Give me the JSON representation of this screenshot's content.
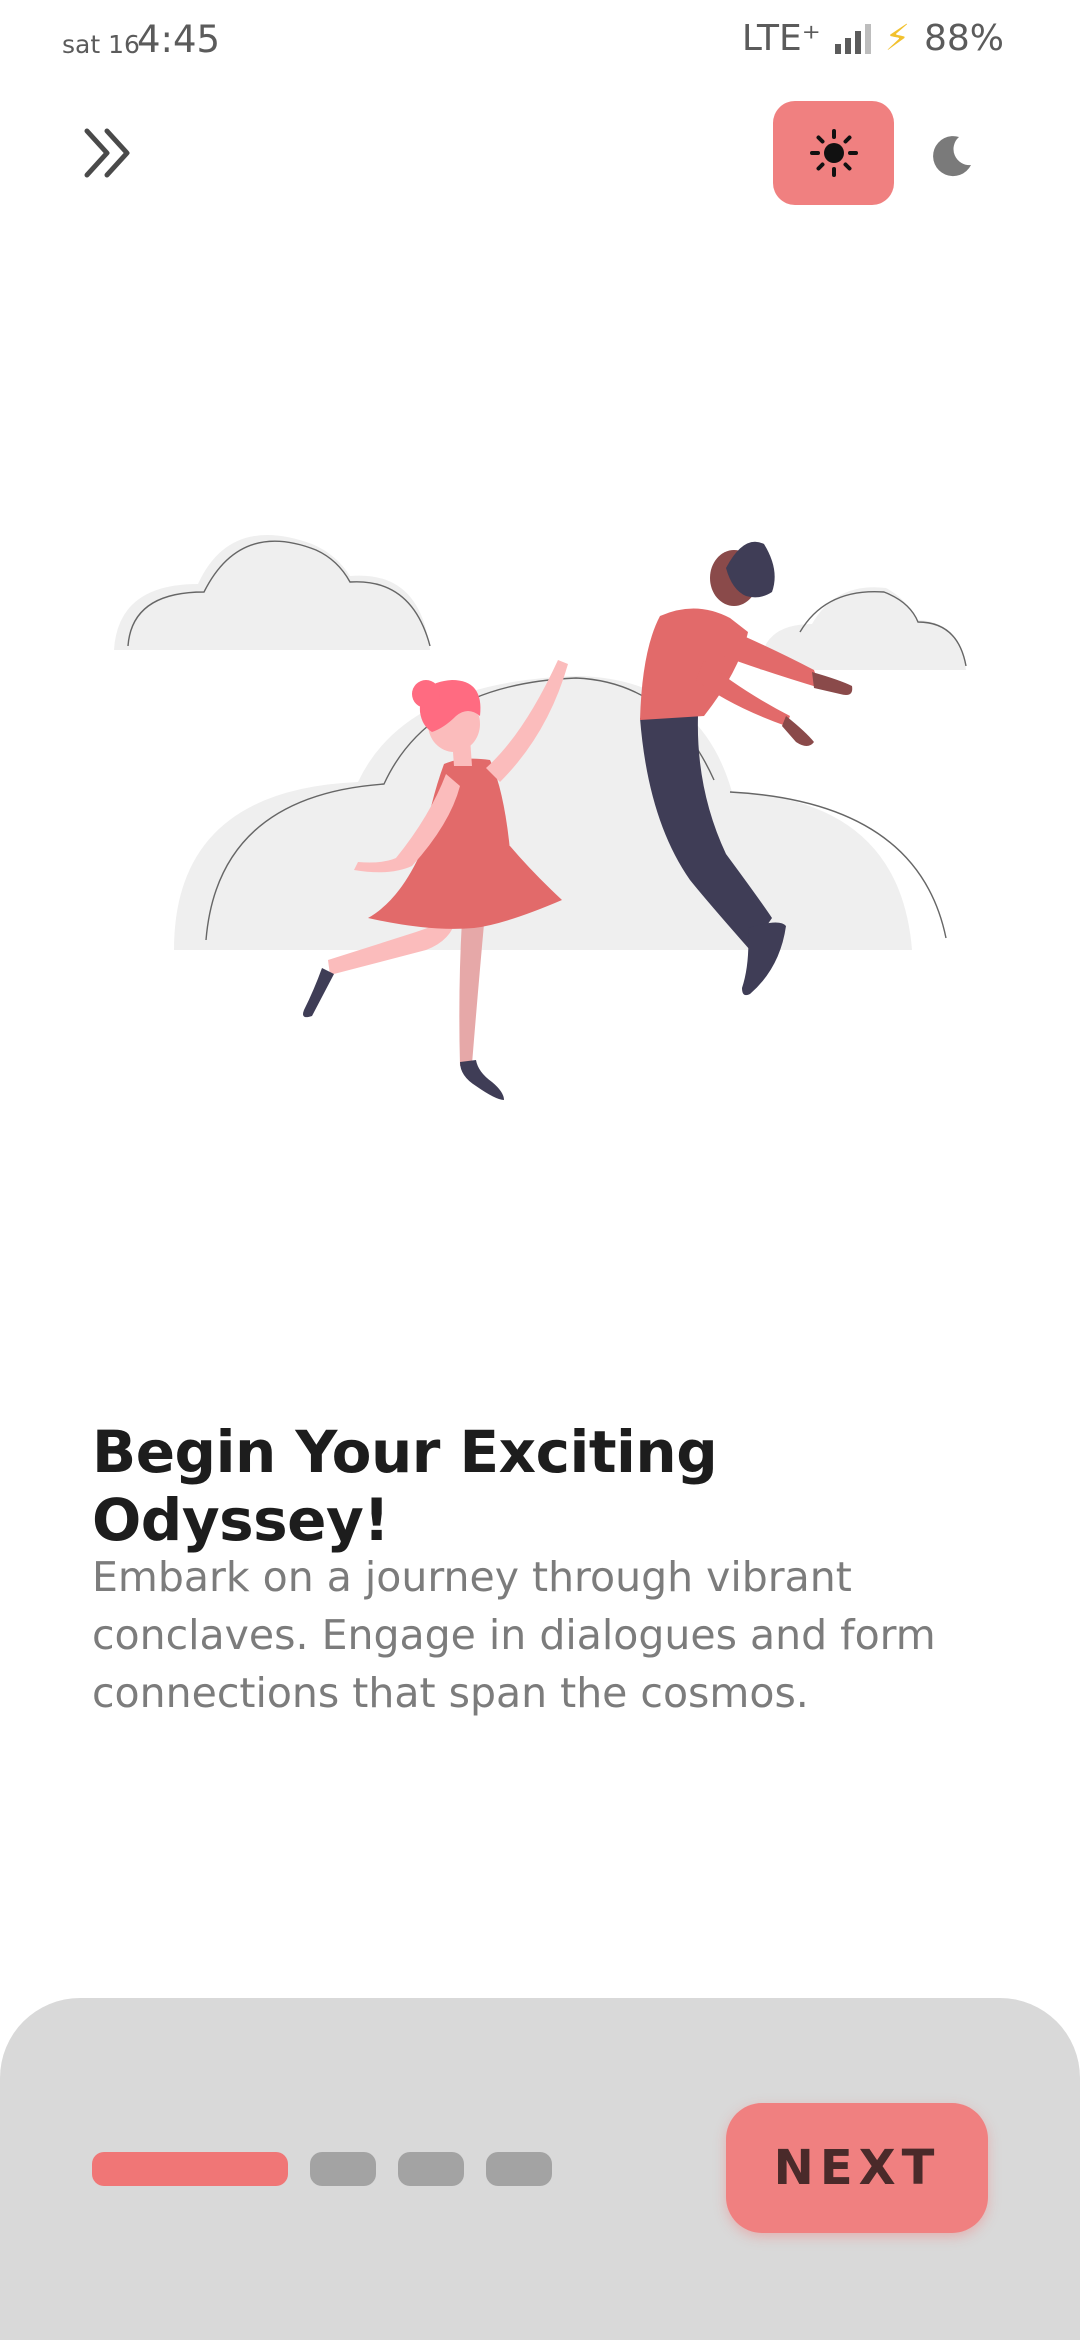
{
  "status_bar": {
    "date": "sat 16",
    "time": "4:45",
    "network": "LTE⁺",
    "battery": "88%",
    "icons": [
      "signal-icon",
      "charging-bolt-icon"
    ]
  },
  "top_bar": {
    "skip_icon": "double-chevron-right-icon",
    "light_mode_icon": "sun-icon",
    "dark_mode_icon": "moon-icon",
    "active_theme": "light"
  },
  "onboarding": {
    "title": "Begin Your Exciting Odyssey!",
    "description": "Embark on a journey through vibrant conclaves. Engage in dialogues and form connections that span the cosmos.",
    "illustration": "dancing-couple-with-clouds-illustration"
  },
  "footer": {
    "page_indicator": {
      "total": 4,
      "current": 1
    },
    "next_label": "NEXT"
  },
  "colors": {
    "accent": "#f08080",
    "panel": "#d9d9d9",
    "dot_inactive": "#a3a3a3",
    "title": "#1d1d1d",
    "body": "#7c7c7c"
  }
}
